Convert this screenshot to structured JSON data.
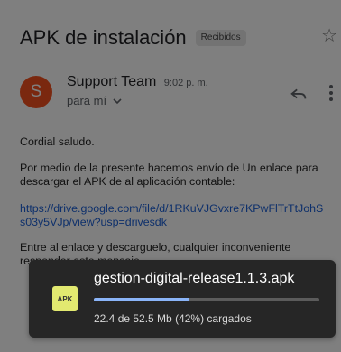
{
  "email": {
    "subject": "APK de instalación",
    "label": "Recibidos",
    "star_icon": "star-outline-icon",
    "sender": {
      "avatar_letter": "S",
      "avatar_color": "#f4511e",
      "name": "Support Team",
      "time": "9:02 p. m.",
      "recipient": "para mí"
    },
    "actions": {
      "reply_icon": "reply-icon",
      "more_icon": "more-vert-icon"
    },
    "body": {
      "greeting": "Cordial saludo.",
      "paragraph1": "Por medio de la presente hacemos envío de Un enlace para descargar el APK de al aplicación contable:",
      "link": "https://drive.google.com/file/d/1RKuVJGvxre7KPwFlTrTtJohSs03y5VJp/view?usp=drivesdk",
      "paragraph2_line1": "Entre al enlace y descarguelo, cualquier inconveniente",
      "paragraph2_line2": "responder este mensaje"
    }
  },
  "download_toast": {
    "file_badge": "APK",
    "file_icon": "apk-file-icon",
    "filename": "gestion-digital-release1.1.3.apk",
    "progress_fraction": 0.42,
    "status": "22.4 de 52.5 Mb (42%) cargados",
    "colors": {
      "background": "#262626",
      "progress": "#8ab4f8",
      "badge": "#e2e970"
    }
  }
}
